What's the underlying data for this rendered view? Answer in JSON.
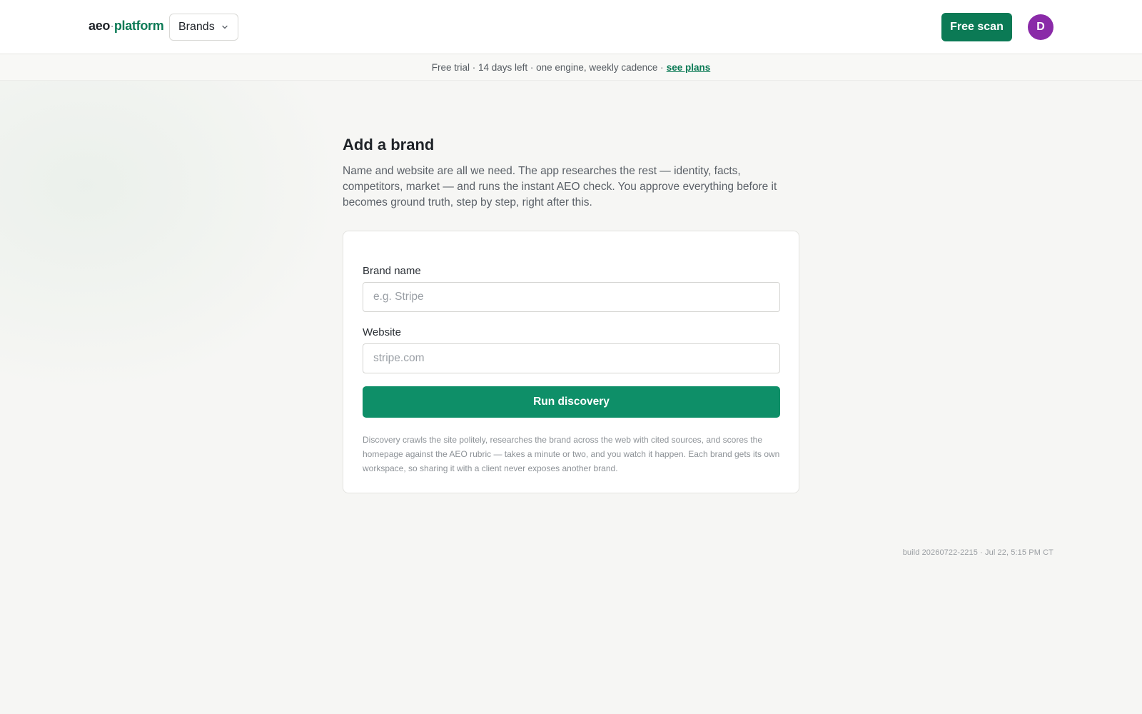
{
  "header": {
    "logo": {
      "part1": "aeo",
      "separator": "·",
      "part2": "platform"
    },
    "brand_switcher_label": "Brands",
    "free_scan_label": "Free scan",
    "avatar_initial": "D"
  },
  "trial_banner": {
    "text": "Free trial · 14 days left · one engine, weekly cadence ·",
    "link_label": "see plans"
  },
  "main": {
    "title": "Add a brand",
    "intro": "Name and website are all we need. The app researches the rest — identity, facts, competitors, market — and runs the instant AEO check. You approve everything before it becomes ground truth, step by step, right after this."
  },
  "form": {
    "brand_name": {
      "label": "Brand name",
      "placeholder": "e.g. Stripe",
      "value": ""
    },
    "website": {
      "label": "Website",
      "placeholder": "stripe.com",
      "value": ""
    },
    "submit_label": "Run discovery",
    "help_text": "Discovery crawls the site politely, researches the brand across the web with cited sources, and scores the homepage against the AEO rubric — takes a minute or two, and you watch it happen. Each brand gets its own workspace, so sharing it with a client never exposes another brand."
  },
  "footer": {
    "build": "build 20260722-2215 · Jul 22, 5:15 PM CT"
  },
  "colors": {
    "brand_green": "#0b7a55",
    "button_green": "#0e8f68",
    "avatar_purple": "#8a2aa8",
    "page_bg": "#f6f6f4"
  },
  "icons": {
    "brand_switcher": "chevron-down-icon"
  }
}
